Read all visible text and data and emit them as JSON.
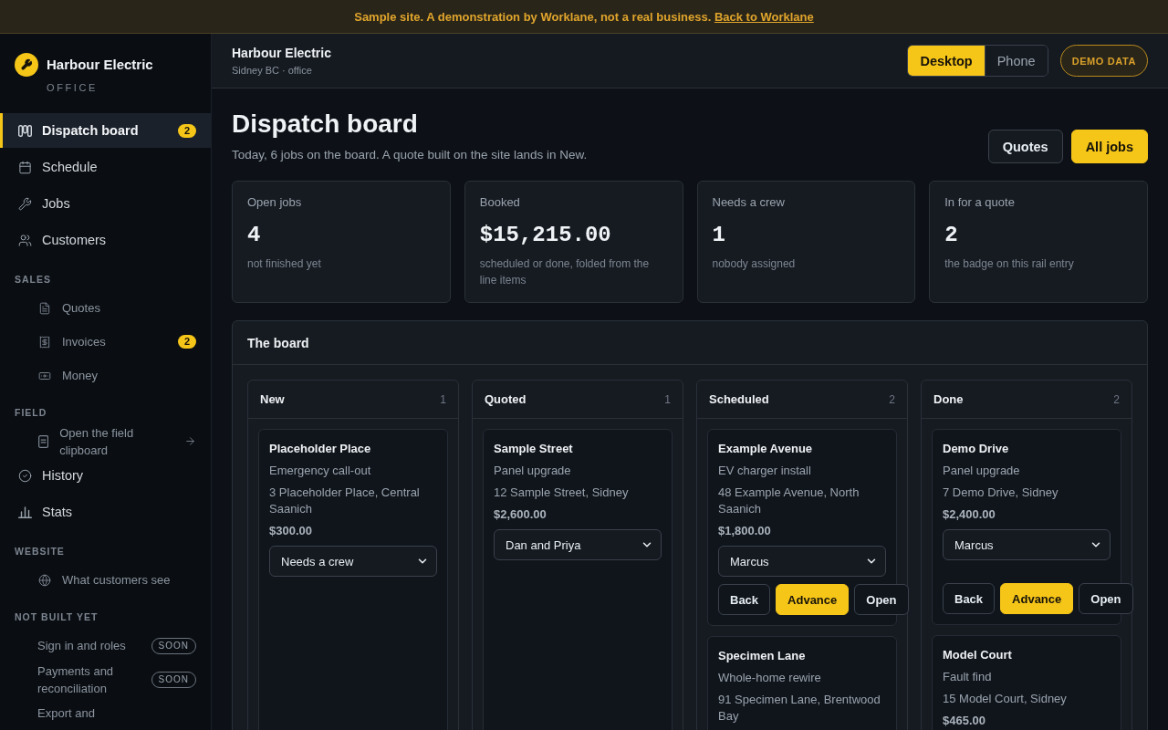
{
  "banner": {
    "text": "Sample site. A demonstration by Worklane, not a real business.",
    "link": "Back to Worklane"
  },
  "sidebar": {
    "brand": {
      "name": "Harbour Electric",
      "subtitle": "OFFICE"
    },
    "items": [
      {
        "kind": "link",
        "label": "Dispatch board",
        "selected": true,
        "badge": "2"
      },
      {
        "kind": "link",
        "label": "Schedule",
        "selected": false
      },
      {
        "kind": "link",
        "label": "Jobs",
        "selected": false
      },
      {
        "kind": "link",
        "label": "Customers",
        "selected": false
      },
      {
        "kind": "heading",
        "label": "SALES"
      },
      {
        "kind": "sublink",
        "label": "Quotes",
        "selected": false
      },
      {
        "kind": "sublink",
        "label": "Invoices",
        "selected": false,
        "badge": "2"
      },
      {
        "kind": "sublink",
        "label": "Money",
        "selected": false
      },
      {
        "kind": "heading",
        "label": "FIELD"
      },
      {
        "kind": "launch",
        "label": "Open the field clipboard",
        "selected": false
      },
      {
        "kind": "link",
        "label": "History",
        "selected": false
      },
      {
        "kind": "link",
        "label": "Stats",
        "selected": false
      },
      {
        "kind": "heading",
        "label": "WEBSITE"
      },
      {
        "kind": "sublink",
        "label": "What customers see",
        "selected": false
      },
      {
        "kind": "heading",
        "label": "NOT BUILT YET"
      },
      {
        "kind": "planned",
        "label": "Sign in and roles",
        "tag": "SOON"
      },
      {
        "kind": "planned",
        "label": "Payments and reconciliation",
        "tag": "SOON"
      },
      {
        "kind": "planned",
        "label": "Export and"
      }
    ]
  },
  "header": {
    "title": "Harbour Electric",
    "subtitle": "Sidney BC · office",
    "view_toggle": [
      {
        "label": "Desktop",
        "selected": true
      },
      {
        "label": "Phone",
        "selected": false
      }
    ],
    "badge": "DEMO DATA"
  },
  "page": {
    "title": "Dispatch board",
    "subtitle": "Today, 6 jobs on the board. A quote built on the site lands in New.",
    "actions": [
      {
        "label": "Quotes",
        "kind": "secondary"
      },
      {
        "label": "All jobs",
        "kind": "primary"
      }
    ]
  },
  "stats": [
    {
      "label": "Open jobs",
      "value": "4",
      "note": "not finished yet"
    },
    {
      "label": "Booked",
      "value": "$15,215.00",
      "note": "scheduled or done, folded from the line items"
    },
    {
      "label": "Needs a crew",
      "value": "1",
      "note": "nobody assigned"
    },
    {
      "label": "In for a quote",
      "value": "2",
      "note": "the badge on this rail entry"
    }
  ],
  "board": {
    "title": "The board",
    "columns": [
      {
        "title": "New",
        "count": "1",
        "jobs": [
          {
            "title": "Placeholder Place",
            "service": "Emergency call-out",
            "address": "3 Placeholder Place, Central Saanich",
            "price": "$300.00",
            "crew": "Needs a crew"
          }
        ]
      },
      {
        "title": "Quoted",
        "count": "1",
        "jobs": [
          {
            "title": "Sample Street",
            "service": "Panel upgrade",
            "address": "12 Sample Street, Sidney",
            "price": "$2,600.00",
            "crew": "Dan and Priya"
          }
        ]
      },
      {
        "title": "Scheduled",
        "count": "2",
        "jobs": [
          {
            "title": "Example Avenue",
            "service": "EV charger install",
            "address": "48 Example Avenue, North Saanich",
            "price": "$1,800.00",
            "crew": "Marcus",
            "actions": [
              {
                "label": "Back",
                "kind": "secondary"
              },
              {
                "label": "Advance",
                "kind": "primary"
              },
              {
                "label": "Open",
                "kind": "secondary"
              }
            ]
          },
          {
            "title": "Specimen Lane",
            "service": "Whole-home rewire",
            "address": "91 Specimen Lane, Brentwood Bay"
          }
        ]
      },
      {
        "title": "Done",
        "count": "2",
        "jobs": [
          {
            "title": "Demo Drive",
            "service": "Panel upgrade",
            "address": "7 Demo Drive, Sidney",
            "price": "$2,400.00",
            "crew": "Marcus",
            "actions": [
              {
                "label": "Back",
                "kind": "secondary"
              },
              {
                "label": "Advance",
                "kind": "primary"
              },
              {
                "label": "Open",
                "kind": "secondary"
              }
            ]
          },
          {
            "title": "Model Court",
            "service": "Fault find",
            "address": "15 Model Court, Sidney",
            "price": "$465.00"
          }
        ]
      }
    ]
  }
}
